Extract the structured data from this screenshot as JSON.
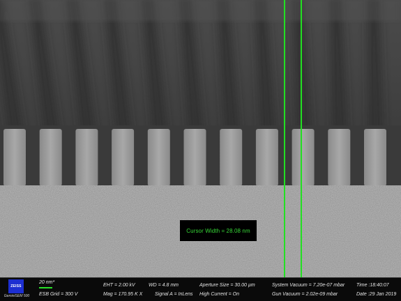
{
  "scalebar": {
    "label": "20 nm*"
  },
  "logo": {
    "brand": "ZEISS",
    "instrument": "GeminiSEM 500"
  },
  "cursor": {
    "readout": "Cursor Width = 28.08 nm"
  },
  "databar": {
    "esb_grid": "ESB Grid = 300 V",
    "eht": "EHT = 2.00 kV",
    "wd": "WD = 4.8 mm",
    "mag": "Mag = 170.95 K X",
    "signal": "Signal A = InLens",
    "aperture": "Aperture Size = 30.00 µm",
    "high_current": "High Current = On",
    "system_vacuum": "System Vacuum = 7.20e-07 mbar",
    "gun_vacuum": "Gun Vacuum = 2.02e-09 mbar",
    "time": "Time :18:40:07",
    "date": "Date :29 Jan 2019"
  },
  "colors": {
    "cursor_line": "#22e022",
    "readout_text": "#37d937",
    "logo_blue": "#1d2fd1"
  }
}
